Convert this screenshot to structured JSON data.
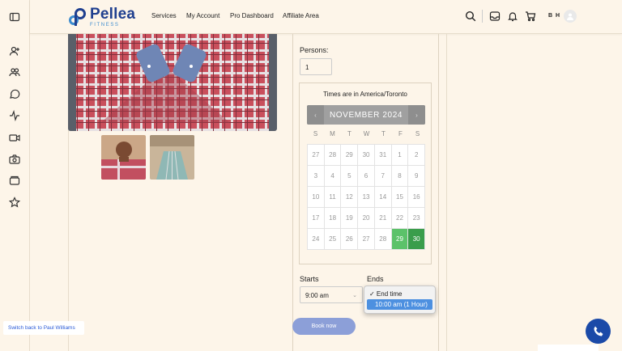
{
  "brand": {
    "name": "Pellea",
    "tagline": "FITNESS",
    "primary_color": "#1f3f8f",
    "accent_color": "#3d8ccf"
  },
  "nav": [
    {
      "label": "Services"
    },
    {
      "label": "My Account"
    },
    {
      "label": "Pro Dashboard"
    },
    {
      "label": "Affiliate Area"
    }
  ],
  "header_icons": [
    "search-icon",
    "inbox-icon",
    "bell-icon",
    "cart-icon"
  ],
  "user": {
    "initials": "B H"
  },
  "sidebar_icons": [
    "sidebar-toggle-icon",
    "user-add-icon",
    "users-icon",
    "chat-icon",
    "activity-icon",
    "video-icon",
    "camera-icon",
    "wallet-icon",
    "star-icon"
  ],
  "booking": {
    "persons_label": "Persons:",
    "persons_value": "1",
    "timezone_note": "Times are in America/Toronto",
    "calendar": {
      "month_title": "NOVEMBER 2024",
      "prev": "‹",
      "next": "›",
      "weekdays": [
        "S",
        "M",
        "T",
        "W",
        "T",
        "F",
        "S"
      ],
      "weeks": [
        [
          "27",
          "28",
          "29",
          "30",
          "31",
          "1",
          "2"
        ],
        [
          "3",
          "4",
          "5",
          "6",
          "7",
          "8",
          "9"
        ],
        [
          "10",
          "11",
          "12",
          "13",
          "14",
          "15",
          "16"
        ],
        [
          "17",
          "18",
          "19",
          "20",
          "21",
          "22",
          "23"
        ],
        [
          "24",
          "25",
          "26",
          "27",
          "28",
          "29",
          "30"
        ]
      ],
      "available_light": "29",
      "available_dark": "30",
      "available_color": "#5cc26a",
      "selected_color": "#3a9d4b"
    },
    "starts_label": "Starts",
    "starts_value": "9:00 am",
    "ends_label": "Ends",
    "ends_options": [
      {
        "label": "✓ End time"
      },
      {
        "label": "10:00 am (1 Hour)"
      }
    ],
    "book_button": "Book now"
  },
  "switch_link": "Switch back to Paul Williams"
}
